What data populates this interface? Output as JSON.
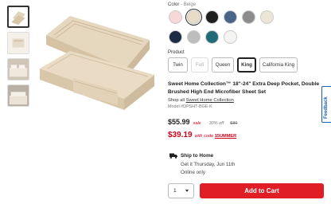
{
  "color": {
    "label": "Color",
    "separator": " - ",
    "selected_name": "Beige",
    "swatches": [
      {
        "name": "pink",
        "hex": "#f6d8d8"
      },
      {
        "name": "beige",
        "hex": "#e9dcc7",
        "selected": true
      },
      {
        "name": "black",
        "hex": "#1f1f1f"
      },
      {
        "name": "slate-blue",
        "hex": "#4a6488"
      },
      {
        "name": "gray",
        "hex": "#8c8c8c"
      },
      {
        "name": "cream",
        "hex": "#ece6d6"
      },
      {
        "name": "navy",
        "hex": "#1c2a44"
      },
      {
        "name": "light-gray",
        "hex": "#bdbdbd"
      },
      {
        "name": "teal",
        "hex": "#1f6b78"
      },
      {
        "name": "white",
        "hex": "#f4f4f2"
      }
    ]
  },
  "product": {
    "label": "Product",
    "sizes": [
      {
        "label": "Twin"
      },
      {
        "label": "Full",
        "disabled": true
      },
      {
        "label": "Queen"
      },
      {
        "label": "King",
        "selected": true
      },
      {
        "label": "California King"
      }
    ],
    "title": "Sweet Home Collection™ 18\"-24\" Extra Deep Pocket, Double Brushed High End Microfiber Sheet Set",
    "shop_all_prefix": "Shop all",
    "brand_link": "Sweet Home Collection",
    "model": "Model #DPSHT-BGE-K"
  },
  "pricing": {
    "price": "$55.99",
    "sale_label": "sale",
    "percent_off": "30% off",
    "original_price": "$80",
    "code_price": "$39.19",
    "code_text": "with code",
    "code": "15UMMER"
  },
  "shipping": {
    "heading": "Ship to Home",
    "estimate": "Get it Thursday, Jun 11th",
    "availability": "Online only"
  },
  "cart": {
    "quantity": "1",
    "button_label": "Add to Cart"
  },
  "feedback_label": "Feedback"
}
